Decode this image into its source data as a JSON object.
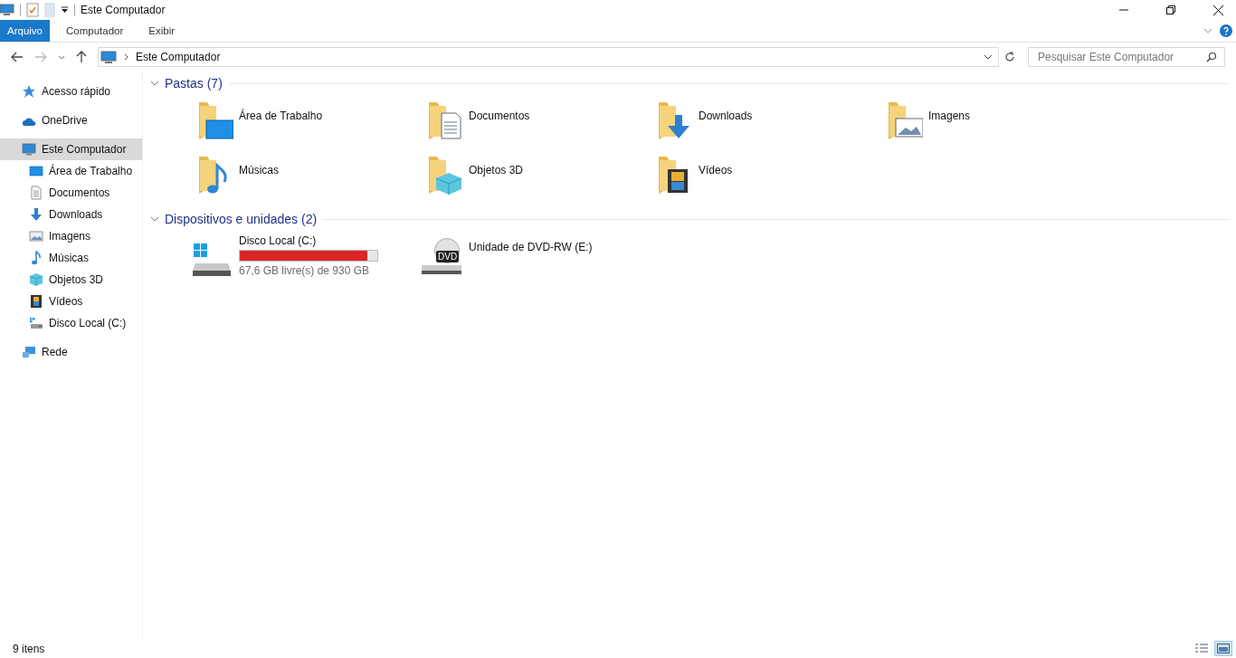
{
  "window": {
    "title": "Este Computador"
  },
  "ribbon": {
    "tabs": [
      {
        "label": "Arquivo",
        "selected": true
      },
      {
        "label": "Computador",
        "selected": false
      },
      {
        "label": "Exibir",
        "selected": false
      }
    ]
  },
  "address": {
    "path": "Este Computador",
    "search_placeholder": "Pesquisar Este Computador"
  },
  "sidebar": {
    "items": [
      {
        "label": "Acesso rápido",
        "kind": "star",
        "selected": false
      },
      {
        "label": "OneDrive",
        "kind": "cloud",
        "selected": false
      },
      {
        "label": "Este Computador",
        "kind": "pc",
        "selected": true,
        "children": [
          {
            "label": "Área de Trabalho",
            "kind": "desktop",
            "selected": false
          },
          {
            "label": "Documentos",
            "kind": "documents",
            "selected": false
          },
          {
            "label": "Downloads",
            "kind": "downloads",
            "selected": false
          },
          {
            "label": "Imagens",
            "kind": "pictures",
            "selected": false
          },
          {
            "label": "Músicas",
            "kind": "music",
            "selected": false
          },
          {
            "label": "Objetos 3D",
            "kind": "objects",
            "selected": false
          },
          {
            "label": "Vídeos",
            "kind": "videos",
            "selected": false
          },
          {
            "label": "Disco Local (C:)",
            "kind": "disk",
            "selected": false
          }
        ]
      },
      {
        "label": "Rede",
        "kind": "network",
        "selected": false
      }
    ]
  },
  "folders": {
    "heading": "Pastas (7)",
    "expanded": true,
    "items": [
      {
        "label": "Área de Trabalho",
        "kind": "desktop"
      },
      {
        "label": "Documentos",
        "kind": "documents"
      },
      {
        "label": "Downloads",
        "kind": "downloads"
      },
      {
        "label": "Imagens",
        "kind": "pictures"
      },
      {
        "label": "Músicas",
        "kind": "music"
      },
      {
        "label": "Objetos 3D",
        "kind": "objects"
      },
      {
        "label": "Vídeos",
        "kind": "videos"
      }
    ]
  },
  "devices": {
    "heading": "Dispositivos e unidades (2)",
    "expanded": true,
    "items": [
      {
        "label": "Disco Local (C:)",
        "kind": "disk",
        "level": 0.93,
        "free": "67,6 GB livre(s) de 930 GB"
      },
      {
        "label": "Unidade de DVD-RW (E:)",
        "kind": "dvd",
        "badge": "DVD"
      }
    ]
  },
  "status_bar": {
    "count": "9 itens",
    "views": [
      {
        "kind": "details",
        "selected": false
      },
      {
        "kind": "large",
        "selected": true
      }
    ]
  }
}
